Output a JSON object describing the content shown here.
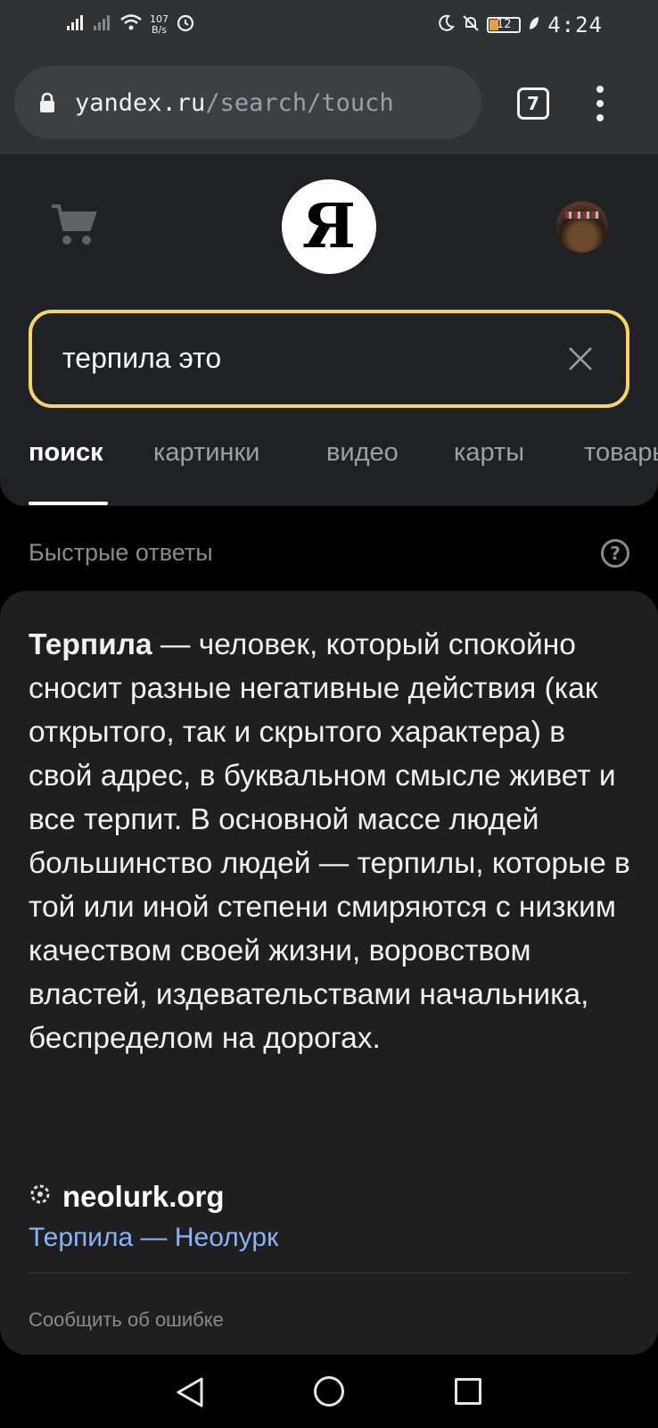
{
  "status_bar": {
    "net_speed": "107",
    "net_unit": "B/s",
    "battery": "12",
    "time": "4:24"
  },
  "browser": {
    "url_host": "yandex.ru",
    "url_path": "/search/touch",
    "tab_count": "7"
  },
  "header": {
    "logo_letter": "Я"
  },
  "search": {
    "query": "терпила это"
  },
  "tabs": [
    {
      "label": "поиск",
      "active": true
    },
    {
      "label": "картинки",
      "active": false
    },
    {
      "label": "видео",
      "active": false
    },
    {
      "label": "карты",
      "active": false
    },
    {
      "label": "товары",
      "active": false
    }
  ],
  "quick_answers": {
    "title": "Быстрые ответы",
    "help": "?"
  },
  "answer": {
    "term": "Терпила",
    "definition": " — человек, который спокойно сносит разные негативные действия (как открытого, так и скрытого характера) в свой адрес, в буквальном смысле живет и все терпит. В основной массе людей большинство людей — терпилы, которые в той или иной степени смиряются с низким качеством своей жизни, воровством властей, издевательствами начальника, беспределом на дорогах.",
    "source_domain": "neolurk.org",
    "source_link": "Терпила — Неолурк",
    "report": "Сообщить об ошибке"
  },
  "colors": {
    "search_border": "#f5d36a",
    "link": "#8ab4f8",
    "background": "#000000",
    "card": "#1f1f20"
  }
}
